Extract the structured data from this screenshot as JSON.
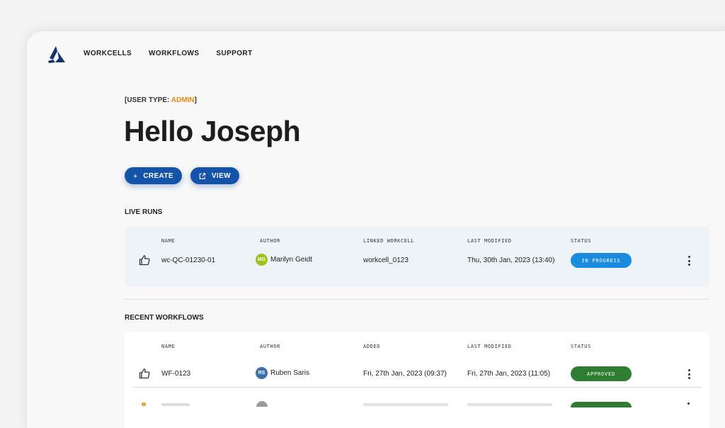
{
  "nav": {
    "items": [
      "WORKCELLS",
      "WORKFLOWS",
      "SUPPORT"
    ]
  },
  "user": {
    "type_prefix": "[USER TYPE: ",
    "role": "ADMIN",
    "type_suffix": "]",
    "greeting": "Hello Joseph"
  },
  "actions": {
    "create_label": "CREATE",
    "view_label": "VIEW"
  },
  "live_runs": {
    "title": "LIVE RUNS",
    "columns": [
      "NAME",
      "AUTHOR",
      "LINKED WORKCELL",
      "LAST MODIFIED",
      "STATUS"
    ],
    "rows": [
      {
        "name": "wc-QC-01230-01",
        "author_initials": "MG",
        "author": "Marilyn Geidt",
        "workcell": "workcell_0123",
        "modified": "Thu, 30th Jan, 2023 (13:40)",
        "status": "IN PROGRESS",
        "status_color": "#1a8ce0",
        "avatar_color": "#9ac31c"
      }
    ]
  },
  "recent_workflows": {
    "title": "RECENT WORKFLOWS",
    "columns": [
      "NAME",
      "AUTHOR",
      "ADDED",
      "LAST MODIFIED",
      "STATUS"
    ],
    "rows": [
      {
        "name": "WF-0123",
        "author_initials": "RS",
        "author": "Ruben Saris",
        "added": "Fri, 27th Jan, 2023 (09:37)",
        "modified": "Fri, 27th Jan, 2023 (11:05)",
        "status": "APPROVED",
        "status_color": "#2e7d32",
        "avatar_color": "#3a6fb0"
      }
    ]
  },
  "colors": {
    "primary": "#1553a8",
    "accent": "#e88a10"
  }
}
